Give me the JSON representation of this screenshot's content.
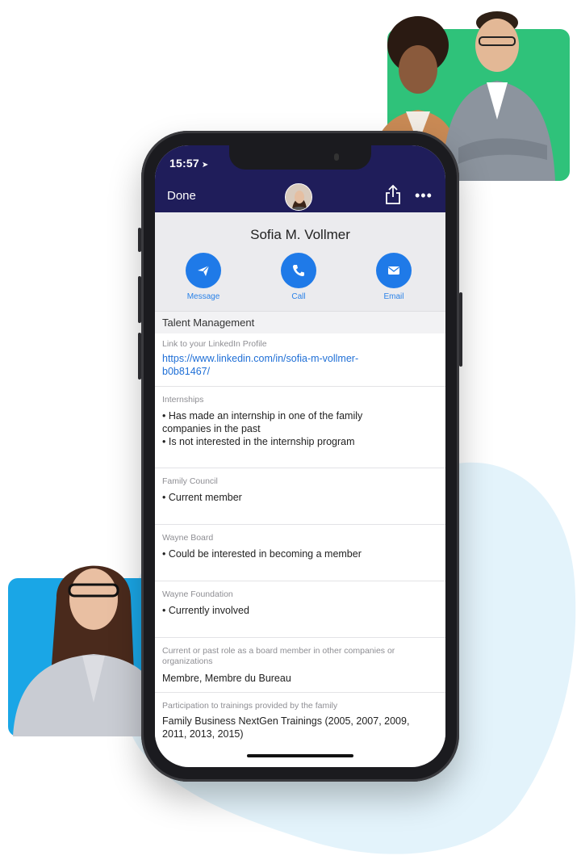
{
  "status": {
    "time": "15:57",
    "location_arrow": "➤"
  },
  "nav": {
    "done_label": "Done",
    "share_icon": "share-icon",
    "more_label": "•••"
  },
  "profile": {
    "name": "Sofia M. Vollmer",
    "actions": [
      {
        "label": "Message",
        "icon": "paper-plane-icon"
      },
      {
        "label": "Call",
        "icon": "phone-icon"
      },
      {
        "label": "Email",
        "icon": "envelope-icon"
      }
    ]
  },
  "section": {
    "title": "Talent Management"
  },
  "fields": {
    "linkedin": {
      "label": "Link to your LinkedIn Profile",
      "line1": "https://www.linkedin.com/in/sofia-m-vollmer-",
      "line2": "b0b81467/"
    },
    "internships": {
      "label": "Internships",
      "line1": "• Has made an internship in one of the family",
      "line2": "companies in the past",
      "line3": "• Is not interested in the internship program"
    },
    "family_council": {
      "label": "Family Council",
      "line1": "• Current member"
    },
    "wayne_board": {
      "label": "Wayne Board",
      "line1": "• Could be interested in becoming a member"
    },
    "wayne_foundation": {
      "label": "Wayne Foundation",
      "line1": "• Currently involved"
    },
    "board_role": {
      "label_line1": "Current or past role as a board member in other companies or",
      "label_line2": "organizations",
      "line1": "Membre, Membre du Bureau"
    },
    "trainings": {
      "label": "Participation to trainings provided by the family",
      "line1": "Family Business NextGen Trainings (2005, 2007, 2009,",
      "line2": "2011, 2013, 2015)"
    }
  },
  "colors": {
    "navy": "#1f1d5a",
    "action_blue": "#1f7ae8",
    "green_card": "#2fc27a",
    "blue_card": "#1aa6e6",
    "blob": "#e3f3fb"
  }
}
